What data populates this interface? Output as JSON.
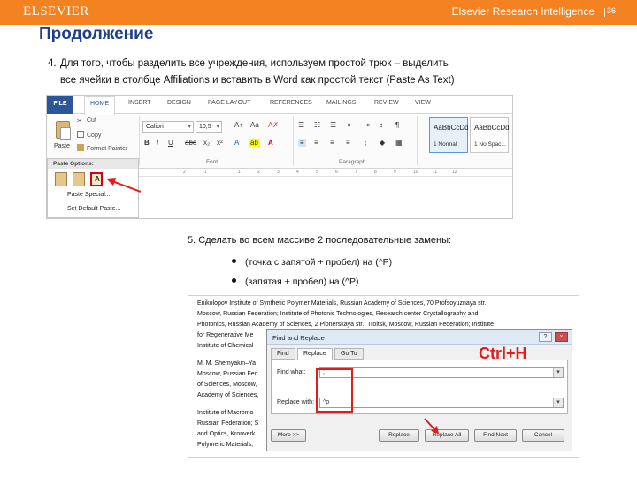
{
  "header": {
    "brand": "ELSEVIER",
    "product": "Elsevier Research Intelligence",
    "page_number": "36"
  },
  "title": "Продолжение",
  "step4": {
    "number": "4.",
    "line1": "Для того, чтобы разделить все учреждения, используем простой трюк – выделить",
    "line2": "все ячейки в столбце Affiliations и вставить в Word как простой текст (Paste As Text)"
  },
  "ribbon": {
    "tabs": [
      "FILE",
      "HOME",
      "INSERT",
      "DESIGN",
      "PAGE LAYOUT",
      "REFERENCES",
      "MAILINGS",
      "REVIEW",
      "VIEW"
    ],
    "clipboard": {
      "cut": "Cut",
      "copy": "Copy",
      "format_painter": "Format Painter",
      "paste": "Paste"
    },
    "font_name": "Calibri",
    "font_size": "10,5",
    "group_font": "Font",
    "group_paragraph": "Paragraph",
    "styles": [
      {
        "sample": "AaBbCcDd",
        "name": "1 Normal"
      },
      {
        "sample": "AaBbCcDd",
        "name": "1 No Spac..."
      }
    ],
    "paste_menu": {
      "header": "Paste Options:",
      "opt_text_glyph": "A",
      "paste_special": "Paste Special...",
      "set_default": "Set Default Paste..."
    },
    "ruler_marks": [
      "2",
      "1",
      "1",
      "2",
      "3",
      "4",
      "5",
      "6",
      "7",
      "8",
      "9",
      "10",
      "11",
      "12"
    ]
  },
  "step5": {
    "line": "5.  Сделать во всем массиве 2 последовательные замены:",
    "bullet1": "(точка с запятой + пробел) на (^P)",
    "bullet2": "(запятая + пробел) на (^P)"
  },
  "document": {
    "lines_top": [
      "Enikolopov Institute of Synthetic Polymer Materials, Russian Academy of Sciences, 70 Profsoyuznaya str.,",
      "Moscow, Russian Federation; Institute of Photonic Technologies, Research center Crystallography and",
      "Photonics, Russian Academy of Sciences, 2 Pionerskaya str., Troitsk, Moscow, Russian Federation; Institute",
      "for Regenerative Me",
      "Institute of Chemical"
    ],
    "lines_mid": [
      "M. M. Shemyakin–Ya",
      "Moscow, Russian Fed",
      "of Sciences, Moscow,",
      "Academy of Sciences,"
    ],
    "lines_bot": [
      "Institute of Macromo",
      "Russian Federation; S",
      "and Optics, Kronverk",
      "Polymeric Materials, "
    ]
  },
  "dialog": {
    "title": "Find and Replace",
    "help": "?",
    "close": "×",
    "tabs": [
      "Find",
      "Replace",
      "Go To"
    ],
    "find_label": "Find what:",
    "find_value": ";",
    "replace_label": "Replace with:",
    "replace_value": "^p",
    "buttons": {
      "more": "More >>",
      "replace": "Replace",
      "replace_all": "Replace All",
      "find_next": "Find Next",
      "cancel": "Cancel"
    }
  },
  "hotkey": "Ctrl+H",
  "colors": {
    "banner": "#f58220",
    "title": "#1c3f8c",
    "highlight": "#e21b1b",
    "word_blue": "#2b579a"
  }
}
